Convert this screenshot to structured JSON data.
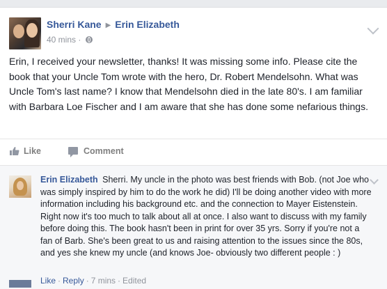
{
  "post": {
    "author": "Sherri Kane",
    "target": "Erin Elizabeth",
    "arrow": "▶",
    "time": "40 mins",
    "time_sep": "·",
    "text": "Erin, I received your newsletter, thanks! It was missing some info. Please cite the book that your Uncle Tom wrote with the hero, Dr. Robert Mendelsohn. What was Uncle Tom's last name? I know that Mendelsohn died in the late 80's. I am familiar with Barbara Loe Fischer and I am aware that she has done some nefarious things.",
    "actions": {
      "like": "Like",
      "comment": "Comment"
    }
  },
  "comment": {
    "author": "Erin Elizabeth",
    "text": "Sherri. My uncle in the photo was best friends with Bob. (not Joe who was simply inspired by him to do the work he did) I'll be doing another video with more information including his background etc. and the connection to Mayer Eistenstein. Right now it's too much to talk about all at once. I also want to discuss with my family before doing this. The book hasn't been in print for over 35 yrs. Sorry if you're not a fan of Barb. She's been great to us and raising attention to the issues since the 80s, and yes she knew my uncle (and knows Joe- obviously two different people : )",
    "like": "Like",
    "reply": "Reply",
    "dot": "·",
    "time": "7 mins",
    "edited": "Edited"
  },
  "colors": {
    "link_blue": "#365899",
    "meta_gray": "#90949c",
    "background": "#e9ebee"
  }
}
